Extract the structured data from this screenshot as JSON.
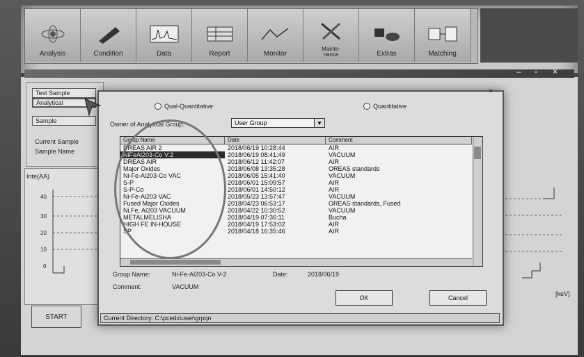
{
  "toolbar": {
    "buttons": [
      {
        "label": "Analysis",
        "icon": "atom-icon"
      },
      {
        "label": "Condition",
        "icon": "pen-icon"
      },
      {
        "label": "Data",
        "icon": "spectrum-icon"
      },
      {
        "label": "Report",
        "icon": "report-icon"
      },
      {
        "label": "Monitor",
        "icon": "monitor-icon"
      },
      {
        "label": "Mainte-\nnance",
        "icon": "tools-icon"
      },
      {
        "label": "Extras",
        "icon": "extras-icon"
      },
      {
        "label": "Matching",
        "icon": "matching-icon"
      }
    ]
  },
  "left_panel": {
    "test_sample": "Test Sample",
    "analytical": "Analytical",
    "sample": "Sample",
    "current_sample": "Current Sample",
    "sample_name": "Sample Name",
    "ylabel": "Inte(AA)",
    "yticks": [
      "40",
      "30",
      "20",
      "10",
      "0"
    ],
    "start": "START",
    "kev": "[keV]"
  },
  "dialog": {
    "tab_qual": "Qual-Quantitative",
    "tab_quant": "Quantitative",
    "owner_label": "Owner of Analytical Group:",
    "owner_value": "User Group",
    "columns": [
      "Group Name",
      "Date",
      "Comment"
    ],
    "rows": [
      {
        "name": "DREAS AIR 2",
        "date": "2018/06/19 10:28:44",
        "comment": "AIR"
      },
      {
        "name": "NiFeAl203-Co V:2",
        "date": "2018/06/19 08:41:49",
        "comment": "VACUUM",
        "selected": true
      },
      {
        "name": "DREAS AIR",
        "date": "2018/06/12 11:42:07",
        "comment": "AIR"
      },
      {
        "name": "Major Oxides",
        "date": "2018/06/08 13:35:28",
        "comment": "OREAS standards"
      },
      {
        "name": "Ni-Fe-Al203-Co VAC",
        "date": "2018/06/05 15:41:40",
        "comment": "VACUUM"
      },
      {
        "name": "S-P",
        "date": "2018/06/01 15:09:57",
        "comment": "AIR"
      },
      {
        "name": "S-P-Co",
        "date": "2018/06/01 14:50:12",
        "comment": "AIR"
      },
      {
        "name": "Ni-Fe-Al203 VAC",
        "date": "2018/05/23 13:57:47",
        "comment": "VACUUM"
      },
      {
        "name": "Fused Major Oxides",
        "date": "2018/04/23 06:53:17",
        "comment": "OREAS standards, Fused"
      },
      {
        "name": "Ni,Fe, Al203 VACUUM",
        "date": "2018/04/22 10:30:52",
        "comment": "VACUUM"
      },
      {
        "name": "METALMELISHA",
        "date": "2018/04/19 07:36:11",
        "comment": "Bucha"
      },
      {
        "name": "HIGH FE IN-HOUSE",
        "date": "2018/04/19 17:53:02",
        "comment": "AIR"
      },
      {
        "name": "SP",
        "date": "2018/04/18 16:35:46",
        "comment": "AIR"
      }
    ],
    "group_name_label": "Group Name:",
    "group_name_value": "Ni-Fe-Al203-Co V-2",
    "date_label": "Date:",
    "date_value": "2018/06/19",
    "comment_label": "Comment:",
    "comment_value": "VACUUM",
    "ok": "OK",
    "cancel": "Cancel",
    "status": "Current Directory: C:\\pcedx\\user\\grpqn"
  }
}
